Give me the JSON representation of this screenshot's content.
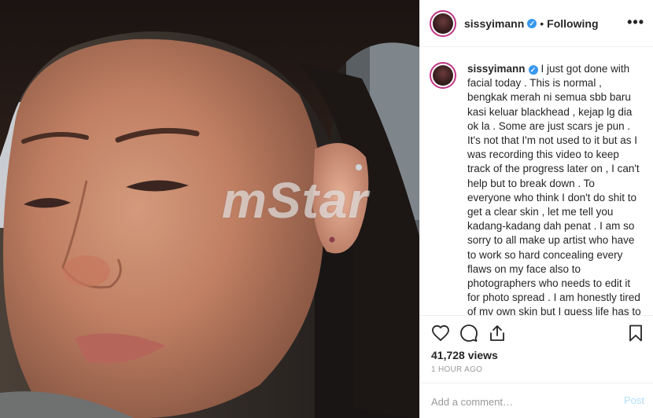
{
  "post": {
    "username": "sissyimann",
    "separator": "•",
    "follow_status": "Following",
    "more_icon": "more-icon",
    "watermark": "mStar",
    "caption": "I just got done with facial today . This is normal , bengkak merah ni semua sbb baru kasi keluar blackhead , kejap lg dia ok la . Some are just scars je pun . It's not that I'm not used to it but as I was recording this video to keep track of the progress later on , I can't help but to break down . To everyone who think I don't do shit to get a clear skin , let me tell you kadang-kadang dah penat . I am so sorry to all make up artist who have to work so hard concealing every flaws on my face also to photographers who needs to edit it for photo spread . I am honestly tired of my own skin but I guess life has to go on and you have to put a lot of effort to make things work . Semoga lebih cantik lepas ni . Kalau tak ada",
    "views": "41,728 views",
    "time_ago": "1 HOUR AGO",
    "comment_placeholder": "Add a comment…",
    "post_label": "Post"
  },
  "colors": {
    "verified": "#3897f0",
    "post_disabled": "#b2dffc",
    "muted": "#999999",
    "avatar_ring": "#c13584"
  }
}
